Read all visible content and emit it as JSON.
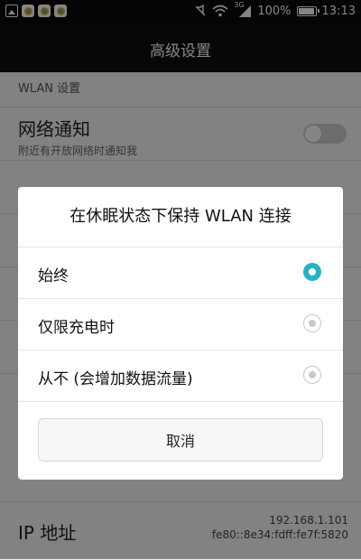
{
  "status_bar": {
    "battery_percent": "100%",
    "time": "13:13",
    "network_type": "3G",
    "battery_level": 1.0
  },
  "title_bar": {
    "title": "高级设置"
  },
  "settings": {
    "section_header": "WLAN 设置",
    "network_notification": {
      "title": "网络通知",
      "subtitle": "附近有开放网络时通知我"
    },
    "ip_address": {
      "label": "IP 地址",
      "ipv4": "192.168.1.101",
      "ipv6": "fe80::8e34:fdff:fe7f:5820"
    }
  },
  "dialog": {
    "title": "在休眠状态下保持 WLAN 连接",
    "options": [
      {
        "label": "始终",
        "selected": true
      },
      {
        "label": "仅限充电时",
        "selected": false
      },
      {
        "label": "从不 (会增加数据流量)",
        "selected": false
      }
    ],
    "cancel_label": "取消"
  },
  "colors": {
    "accent": "#27b3c3",
    "overlay": "#000000"
  }
}
